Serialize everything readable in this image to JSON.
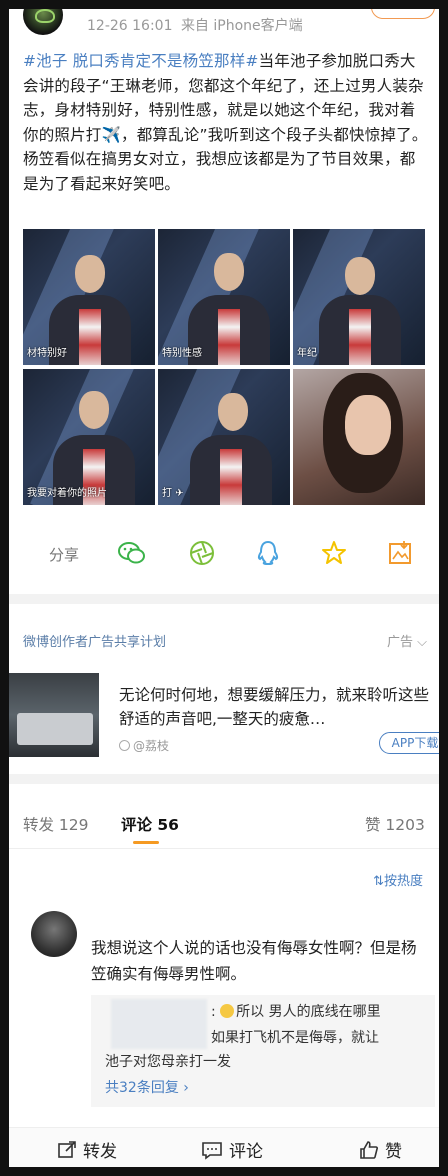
{
  "post": {
    "timestamp": "12-26 16:01",
    "source_prefix": "来自",
    "source": "iPhone客户端",
    "hashtag": "#池子 脱口秀肯定不是杨笠那样#",
    "body": "当年池子参加脱口秀大会讲的段子“王琳老师，您都这个年纪了，还上过男人装杂志，身材特别好，特别性感，就是以她这个年纪，我对着你的照片打✈️，都算乱论”我听到这个段子头都快惊掉了。杨笠看似在搞男女对立，我想应该都是为了节目效果，都是为了看起来好笑吧。",
    "images": [
      {
        "caption": "材特别好",
        "watermark": ""
      },
      {
        "caption": "特别性感",
        "watermark": ""
      },
      {
        "caption": "年纪",
        "watermark": ""
      },
      {
        "caption": "我要对着你的照片",
        "watermark": ""
      },
      {
        "caption": "打 ✈",
        "watermark": ""
      },
      {
        "caption": "",
        "watermark": ""
      }
    ]
  },
  "actions": {
    "share_label": "分享",
    "icons": [
      "wechat-icon",
      "moments-icon",
      "qq-icon",
      "qzone-icon",
      "save-image-icon"
    ]
  },
  "ad": {
    "source": "微博创作者广告共享计划",
    "tag": "广告",
    "text": "无论何时何地，想要缓解压力，就来聆听这些舒适的声音吧,一整天的疲惫…",
    "author": "@荔枝",
    "button": "APP下载"
  },
  "tabs": {
    "repost": "转发 129",
    "comment": "评论 56",
    "like": "赞 1203"
  },
  "sort_label": "按热度",
  "comment": {
    "text": "我想说这个人说的话也没有侮辱女性啊？但是杨笠确实有侮辱男性啊。",
    "reply_line1": ":",
    "reply_line1_text": "所以 男人的底线在哪里",
    "reply_line2": "如果打飞机不是侮辱，就让",
    "reply_line3": "池子对您母亲打一发",
    "reply_more": "共32条回复 ›"
  },
  "bottom_bar": {
    "repost": "转发",
    "comment": "评论",
    "like": "赞"
  },
  "colors": {
    "link": "#4a7fc1",
    "accent": "#f59a23",
    "wechat": "#3bb34a",
    "moments": "#7cbf3a",
    "qq": "#4aa3df",
    "qzone": "#f4c300",
    "save": "#f29a2e"
  }
}
